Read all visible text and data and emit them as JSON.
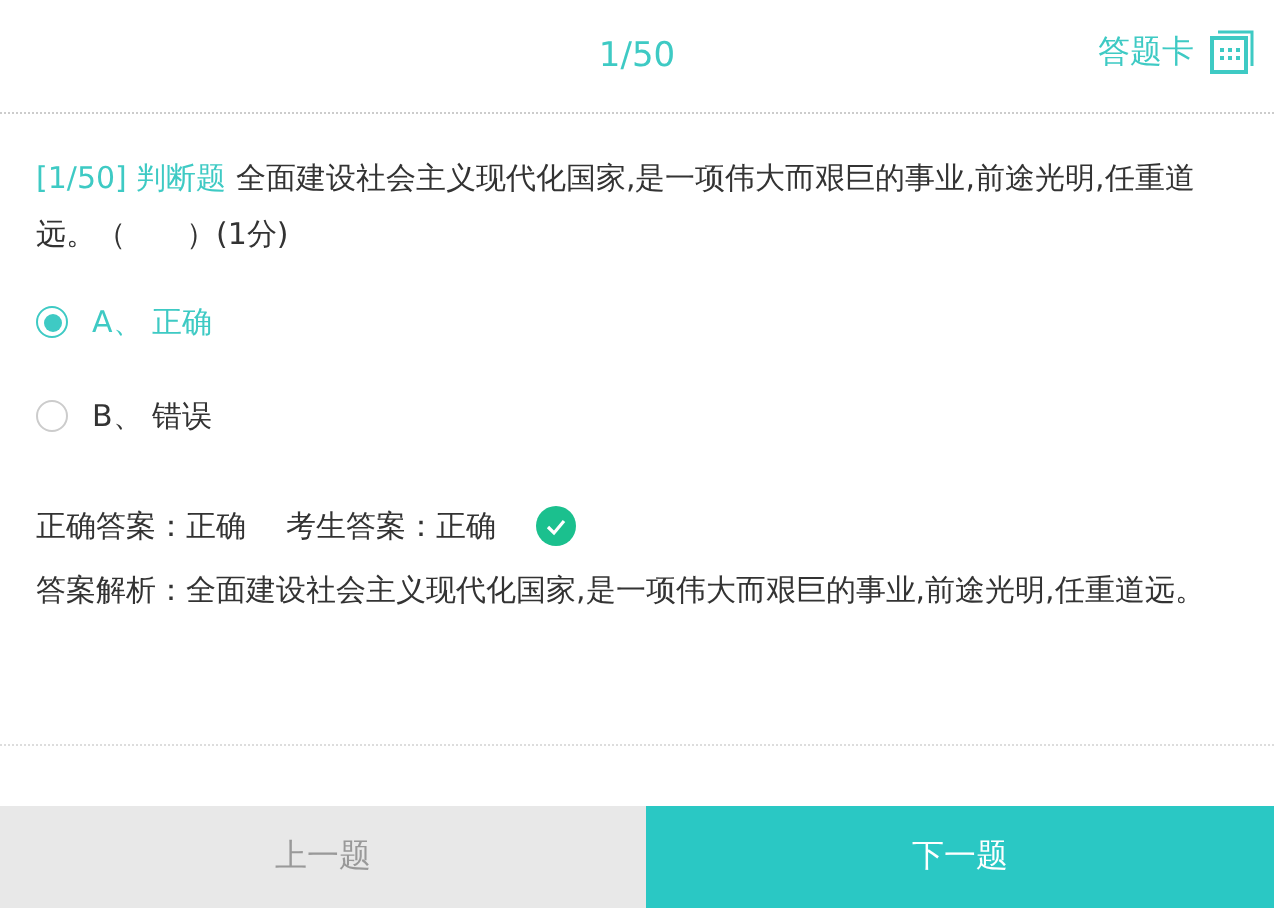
{
  "header": {
    "progress": "1/50",
    "answer_card": "答题卡"
  },
  "question": {
    "number": "[1/50]",
    "type": "判断题",
    "text": "全面建设社会主义现代化国家,是一项伟大而艰巨的事业,前途光明,任重道远。（　　）(1分)"
  },
  "options": [
    {
      "label": "A、 正确",
      "selected": true
    },
    {
      "label": "B、 错误",
      "selected": false
    }
  ],
  "result": {
    "correct_answer": "正确答案：正确",
    "your_answer": "考生答案：正确",
    "correct": true
  },
  "analysis": "答案解析：全面建设社会主义现代化国家,是一项伟大而艰巨的事业,前途光明,任重道远。",
  "buttons": {
    "prev": "上一题",
    "next": "下一题"
  }
}
